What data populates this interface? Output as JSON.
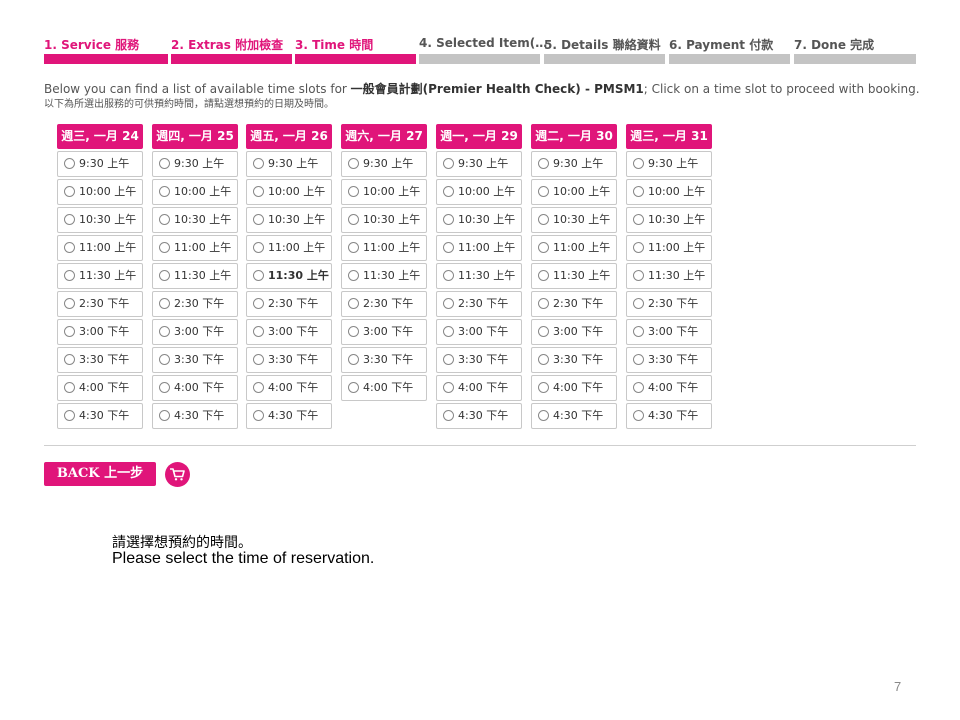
{
  "steps": [
    {
      "label": "1. Service 服務",
      "active": true
    },
    {
      "label": "2. Extras 附加檢查",
      "active": true
    },
    {
      "label": "3. Time 時間",
      "active": true
    },
    {
      "label": "4. Selected Item(…",
      "active": false
    },
    {
      "label": "5. Details 聯絡資料",
      "active": false
    },
    {
      "label": "6. Payment 付款",
      "active": false
    },
    {
      "label": "7. Done 完成",
      "active": false
    }
  ],
  "intro": {
    "prefix": "Below you can find a list of available time slots for ",
    "service": "一般會員計劃(Premier Health Check) - PMSM1",
    "suffix": "; Click on a time slot to proceed with booking.",
    "line2": "以下為所選出服務的可供預約時間，請點選想預約的日期及時間。"
  },
  "days": [
    {
      "label": "週三, 一月 24",
      "slots": [
        "9:30 上午",
        "10:00 上午",
        "10:30 上午",
        "11:00 上午",
        "11:30 上午",
        "2:30 下午",
        "3:00 下午",
        "3:30 下午",
        "4:00 下午",
        "4:30 下午"
      ]
    },
    {
      "label": "週四, 一月 25",
      "slots": [
        "9:30 上午",
        "10:00 上午",
        "10:30 上午",
        "11:00 上午",
        "11:30 上午",
        "2:30 下午",
        "3:00 下午",
        "3:30 下午",
        "4:00 下午",
        "4:30 下午"
      ]
    },
    {
      "label": "週五, 一月 26",
      "slots": [
        "9:30 上午",
        "10:00 上午",
        "10:30 上午",
        "11:00 上午",
        "11:30 上午",
        "2:30 下午",
        "3:00 下午",
        "3:30 下午",
        "4:00 下午",
        "4:30 下午"
      ],
      "selected": 4
    },
    {
      "label": "週六, 一月 27",
      "slots": [
        "9:30 上午",
        "10:00 上午",
        "10:30 上午",
        "11:00 上午",
        "11:30 上午",
        "2:30 下午",
        "3:00 下午",
        "3:30 下午",
        "4:00 下午"
      ]
    },
    {
      "label": "週一, 一月 29",
      "slots": [
        "9:30 上午",
        "10:00 上午",
        "10:30 上午",
        "11:00 上午",
        "11:30 上午",
        "2:30 下午",
        "3:00 下午",
        "3:30 下午",
        "4:00 下午",
        "4:30 下午"
      ]
    },
    {
      "label": "週二, 一月 30",
      "slots": [
        "9:30 上午",
        "10:00 上午",
        "10:30 上午",
        "11:00 上午",
        "11:30 上午",
        "2:30 下午",
        "3:00 下午",
        "3:30 下午",
        "4:00 下午",
        "4:30 下午"
      ]
    },
    {
      "label": "週三, 一月 31",
      "slots": [
        "9:30 上午",
        "10:00 上午",
        "10:30 上午",
        "11:00 上午",
        "11:30 上午",
        "2:30 下午",
        "3:00 下午",
        "3:30 下午",
        "4:00 下午",
        "4:30 下午"
      ]
    }
  ],
  "buttons": {
    "back_label": "BACK 上一步",
    "cart_icon": "cart-icon"
  },
  "note": {
    "zh": "請選擇想預約的時間。",
    "en": "Please select the time of reservation."
  },
  "page_number": "7",
  "colors": {
    "accent": "#e0157a",
    "inactive_bar": "#c4c4c4"
  }
}
